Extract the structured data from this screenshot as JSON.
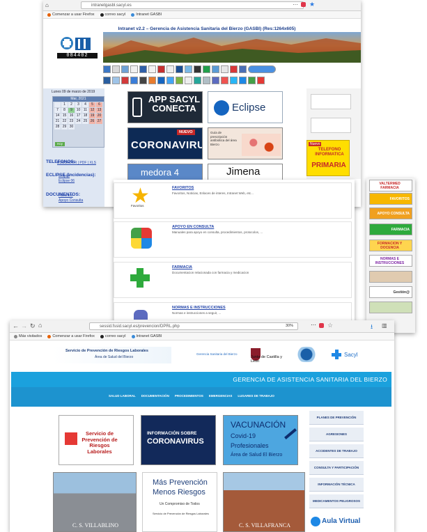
{
  "panel1": {
    "url": "intranetgasbl.sacyl.es",
    "bookmarks": [
      "Comenzar a usar Firefox",
      "correo sacyl",
      "Intranet GASBI"
    ],
    "header": "Intranet v2.2 – Gerencia de Asistencia Sanitaria del Bierzo (GASBI) (Res:1264x605)",
    "logo_number": "084402",
    "calendar": {
      "title": "Lunes 09 de marzo de 2019",
      "month": "Mar, 2021",
      "days": [
        "",
        "1",
        "2",
        "3",
        "4",
        "5",
        "6",
        "7",
        "8",
        "9",
        "10",
        "11",
        "12",
        "13",
        "14",
        "15",
        "16",
        "17",
        "18",
        "19",
        "20",
        "21",
        "22",
        "23",
        "24",
        "25",
        "26",
        "27",
        "28",
        "29",
        "30",
        "31",
        "",
        "",
        ""
      ],
      "today": "Hoy"
    },
    "sidebar": {
      "telefonos": "TELEFONOS:",
      "telefonos_link": "BUSCADOR | PDF | XLS",
      "eclipse": "ECLIPSE (Incidencias):",
      "eclipse_links": [
        "Eclipse",
        "Eclipse 06"
      ],
      "documentos": "DOCUMENTOS:",
      "documentos_links": [
        "Favoritos",
        "Apoyo Consulta"
      ]
    },
    "tiles": {
      "app": "APP SACYL CONECTA",
      "eclipse": "Eclipse",
      "coronavirus": "CORONAVIRUS",
      "nuevo": "NUEVO",
      "guia": "Guía de prescripción antibiótica del área Bierzo",
      "medora": "medora 4",
      "jimena": "Jimena"
    },
    "right_col": {
      "nuevo_label": "Nuevo",
      "telefono": "TELEFONO INFORMATICA",
      "primaria": "PRIMARIA"
    }
  },
  "panel2": {
    "cards": [
      {
        "title": "FAVORITOS",
        "desc": "Favoritos, Noticias, Enlaces de interes, Intranet Web, etc...",
        "icon_label": "Favoritos"
      },
      {
        "title": "APOYO EN CONSULTA",
        "desc": "Manuales para apoyo en consulta, procedimientos, protocolos, ...",
        "icon_label": ""
      },
      {
        "title": "FARMACIA",
        "desc": "Documentacion relacionada con farmacia y medicacion",
        "icon_label": ""
      },
      {
        "title": "NORMAS E INSTRUCCIONES",
        "desc": "Normas e instrucciones a seguir, ...",
        "icon_label": ""
      }
    ],
    "side_menu": [
      "VALTERMED FARMACIA",
      "FAVORITOS",
      "APOYO CONSULTA",
      "FARMACIA",
      "FORMACION Y DOCENCIA",
      "NORMAS E INSTRUCCIONES",
      "",
      "Gestión@",
      ""
    ]
  },
  "panel3": {
    "url": "sessid.fssid.sacyl.es/prevencion/DPRL.php",
    "zoom": "30%",
    "bookmarks": [
      "Más visitados",
      "Comenzar a usar Firefox",
      "correo sacyl",
      "Intranet GASBI"
    ],
    "spr_title": "Servicio de Prevención de Riesgos Laborales",
    "spr_sub": "Área de Salud del Bierzo",
    "gerencia_small": "Gerencia Sanitaria del Bierzo",
    "junta": "Junta de Castilla y León",
    "sacyl": "Sacyl",
    "gerencia": "GERENCIA DE ASISTENCIA SANITARIA DEL BIERZO",
    "nav": [
      "SALUD LABORAL",
      "DOCUMENTACIÓN",
      "PROCEDIMIENTOS",
      "EMERGENCIAS",
      "LUGARES DE TRABAJO"
    ],
    "tiles": {
      "servicio": "Servicio de Prevención de Riesgos Laborales",
      "info_corona_1": "INFORMACIÓN SOBRE",
      "info_corona_2": "CORONAVIRUS",
      "vacunacion": "VACUNACIÓN",
      "covid": "Covid-19",
      "profesionales": "Profesionales",
      "area": "Área de Salud El Bierzo",
      "villablino": "C. S. VILLABLINO",
      "mas_prevencion_1": "Más Prevención",
      "mas_prevencion_2": "Menos Riesgos",
      "compromiso": "Un Compromiso de Todos",
      "servicio_small": "Servicio de Prevención de Riesgos Laborales",
      "villafranca": "C. S. VILLAFRANCA",
      "aula": "Aula Virtual"
    },
    "right_menu": [
      "PLANES DE PREVENCIÓN",
      "AGRESIONES",
      "ACCIDENTES DE TRABAJO",
      "CONSULTA Y PARTICIPACIÓN",
      "INFORMACIÓN TÉCNICA",
      "MEDICAMENTOS PELIGROSOS"
    ]
  }
}
